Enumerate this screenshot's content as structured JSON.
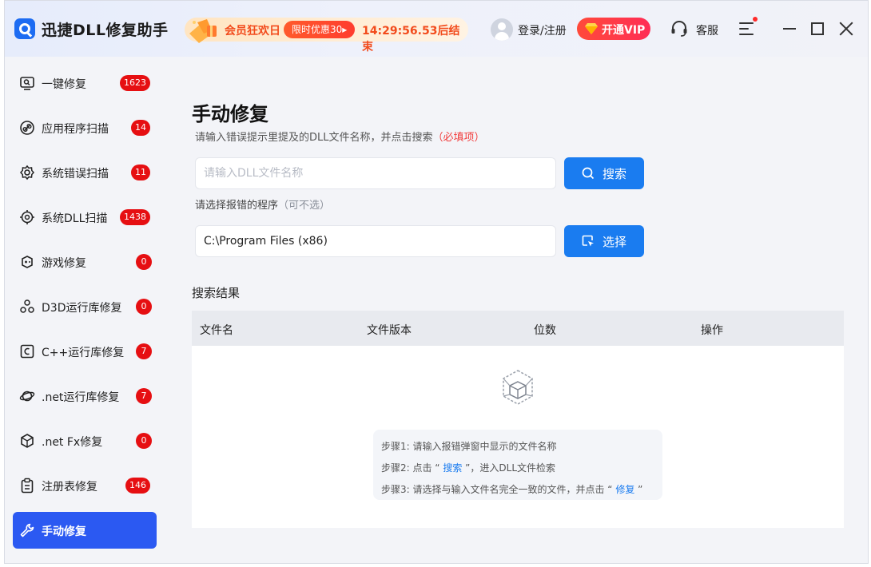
{
  "app": {
    "title": "迅捷DLL修复助手"
  },
  "promo": {
    "text": "会员狂欢日",
    "pill": "限时优惠30▸",
    "countdown": "14:29:56.53后结束"
  },
  "header": {
    "login": "登录/注册",
    "vip": "开通VIP",
    "service": "客服"
  },
  "sidebar": {
    "items": [
      {
        "label": "一键修复",
        "badge": "1623",
        "icon": "monitor-search-icon"
      },
      {
        "label": "应用程序扫描",
        "badge": "14",
        "icon": "link-icon"
      },
      {
        "label": "系统错误扫描",
        "badge": "11",
        "icon": "gear-icon"
      },
      {
        "label": "系统DLL扫描",
        "badge": "1438",
        "icon": "target-gear-icon"
      },
      {
        "label": "游戏修复",
        "badge": "0",
        "icon": "gamepad-icon"
      },
      {
        "label": "D3D运行库修复",
        "badge": "0",
        "icon": "nodes-icon"
      },
      {
        "label": "C++运行库修复",
        "badge": "7",
        "icon": "c-box-icon"
      },
      {
        "label": ".net运行库修复",
        "badge": "7",
        "icon": "planet-icon"
      },
      {
        "label": ".net Fx修复",
        "badge": "0",
        "icon": "cube-icon"
      },
      {
        "label": "注册表修复",
        "badge": "146",
        "icon": "clipboard-icon"
      },
      {
        "label": "手动修复",
        "badge": "",
        "icon": "wrench-icon"
      }
    ]
  },
  "main": {
    "title": "手动修复",
    "hint": "请输入错误提示里提及的DLL文件名称，并点击搜索",
    "required": "（必填项）",
    "search_placeholder": "请输入DLL文件名称",
    "search_button": "搜索",
    "program_hint": "请选择报错的程序",
    "optional": "（可不选）",
    "program_path": "C:\\Program Files (x86)",
    "select_button": "选择",
    "results_title": "搜索结果",
    "columns": [
      "文件名",
      "文件版本",
      "位数",
      "操作"
    ],
    "steps": {
      "step1": "步骤1: 请输入报错弹窗中显示的文件名称",
      "step2_pre": "步骤2: 点击 “",
      "step2_link": " 搜索 ",
      "step2_post": "”，进入DLL文件检索",
      "step3_pre": "步骤3: 请选择与输入文件名完全一致的文件，并点击 “",
      "step3_link": " 修复 ",
      "step3_post": "”"
    }
  },
  "colors": {
    "accent": "#1a7cf0",
    "active_nav": "#2b59f2",
    "badge": "#e60f12",
    "promo": "#f24b1c",
    "vip": "#ff3a45"
  }
}
